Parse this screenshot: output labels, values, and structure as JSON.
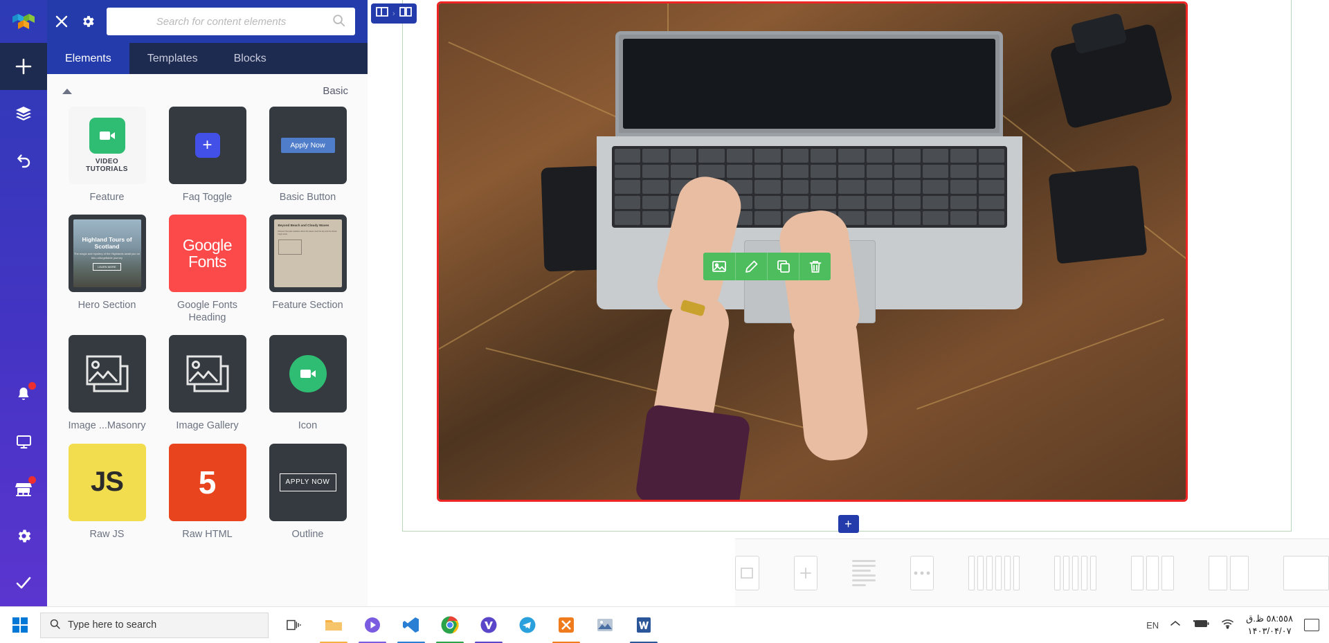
{
  "app": {
    "logo_icon": "colored-cubes-logo",
    "close_icon": "close-icon",
    "settings_icon": "gear-icon"
  },
  "rail": {
    "items": [
      {
        "icon": "plus-icon",
        "name": "add-element",
        "active": true,
        "badge": false
      },
      {
        "icon": "layers-icon",
        "name": "layers",
        "active": false,
        "badge": false
      },
      {
        "icon": "undo-icon",
        "name": "undo",
        "active": false,
        "badge": false
      },
      {
        "icon": "bell-icon",
        "name": "notifications",
        "active": false,
        "badge": true
      },
      {
        "icon": "monitor-icon",
        "name": "preview-desktop",
        "active": false,
        "badge": false
      },
      {
        "icon": "store-icon",
        "name": "marketplace",
        "active": false,
        "badge": true
      },
      {
        "icon": "gear-icon",
        "name": "settings",
        "active": false,
        "badge": false
      },
      {
        "icon": "check-icon",
        "name": "publish",
        "active": false,
        "badge": false
      }
    ]
  },
  "search": {
    "placeholder": "Search for content elements",
    "value": "",
    "icon": "search-icon"
  },
  "tabs": [
    {
      "label": "Elements",
      "active": true
    },
    {
      "label": "Templates",
      "active": false
    },
    {
      "label": "Blocks",
      "active": false
    }
  ],
  "group": {
    "title": "Basic",
    "collapse_icon": "caret-up-icon"
  },
  "elements": [
    {
      "label": "Feature",
      "thumb": "feature",
      "thumb_text_line1": "VIDEO",
      "thumb_text_line2": "TUTORIALS",
      "icon": "video-camera-icon"
    },
    {
      "label": "Faq Toggle",
      "thumb": "faq",
      "icon": "plus-icon"
    },
    {
      "label": "Basic Button",
      "thumb": "button",
      "button_label": "Apply Now"
    },
    {
      "label": "Hero Section",
      "thumb": "hero",
      "hero_title": "Highland Tours of Scotland",
      "hero_sub": "The magic and mystery of the Highlands await you on this unforgettable journey",
      "hero_button": "LEARN MORE"
    },
    {
      "label": "Google Fonts Heading",
      "thumb": "gfonts",
      "line1": "Google",
      "line2": "Fonts"
    },
    {
      "label": "Feature Section",
      "thumb": "featsec",
      "fs_title": "Beyond Beach and Cloudy Waves",
      "fs_body": "Discover the quiet coastline where the waves meet the sky and the stories begin anew."
    },
    {
      "label": "Image ...Masonry",
      "thumb": "dark",
      "icon": "images-stack-icon"
    },
    {
      "label": "Image Gallery",
      "thumb": "dark",
      "icon": "images-stack-icon"
    },
    {
      "label": "Icon",
      "thumb": "icon",
      "icon": "video-circle-icon"
    },
    {
      "label": "Raw JS",
      "thumb": "js",
      "text": "JS"
    },
    {
      "label": "Raw HTML",
      "thumb": "html5",
      "text": "5"
    },
    {
      "label": "Outline",
      "thumb": "outline",
      "button_label": "APPLY NOW"
    }
  ],
  "canvas": {
    "row_tools": {
      "layout_icon": "columns-layout-icon",
      "separator": "›",
      "split_icon": "split-columns-icon"
    },
    "image_toolbar": [
      {
        "icon": "image-icon",
        "name": "change-image"
      },
      {
        "icon": "pencil-icon",
        "name": "edit-image"
      },
      {
        "icon": "copy-icon",
        "name": "duplicate-image"
      },
      {
        "icon": "trash-icon",
        "name": "delete-image"
      }
    ],
    "add_block_icon": "plus-icon",
    "selection_color": "#ef2424",
    "toolbar_color": "#4dbd5e"
  },
  "bottom_strip": {
    "items": [
      {
        "name": "layout-single-box",
        "icon": "box-icon"
      },
      {
        "name": "layout-add",
        "icon": "plus-icon"
      },
      {
        "name": "layout-text",
        "icon": "text-lines-icon"
      },
      {
        "name": "layout-more",
        "icon": "dots-icon"
      },
      {
        "name": "layout-5-columns",
        "icon": "five-columns-icon"
      },
      {
        "name": "layout-4-columns",
        "icon": "four-columns-icon"
      },
      {
        "name": "layout-3-columns",
        "icon": "three-columns-icon"
      },
      {
        "name": "layout-2-columns",
        "icon": "two-columns-icon"
      },
      {
        "name": "layout-1-column",
        "icon": "one-column-icon"
      }
    ]
  },
  "taskbar": {
    "start_icon": "windows-logo",
    "search_placeholder": "Type here to search",
    "search_icon": "search-icon",
    "apps": [
      {
        "name": "task-view",
        "icon": "task-view-icon",
        "color": "#3a3a3a"
      },
      {
        "name": "file-explorer",
        "icon": "folder-icon",
        "color": "#f5b041"
      },
      {
        "name": "media-player",
        "icon": "media-player-icon",
        "color": "#7b5ce0"
      },
      {
        "name": "visual-studio-code",
        "icon": "vscode-icon",
        "color": "#2a7fd4"
      },
      {
        "name": "google-chrome",
        "icon": "chrome-icon",
        "color": "#2aa34a"
      },
      {
        "name": "vite-app",
        "icon": "v-icon",
        "color": "#5a46c8"
      },
      {
        "name": "telegram",
        "icon": "telegram-icon",
        "color": "#2aa0dc"
      },
      {
        "name": "xampp",
        "icon": "xampp-icon",
        "color": "#f07b1d"
      },
      {
        "name": "photos",
        "icon": "photos-icon",
        "color": "#4a6fa5"
      },
      {
        "name": "word",
        "icon": "word-icon",
        "color": "#2b579a"
      }
    ],
    "tray": {
      "language": "EN",
      "chevron_icon": "chevron-up-icon",
      "battery_icon": "battery-charging-icon",
      "network_icon": "wifi-icon",
      "time": "٥٨:٥٥٨ ظ.ق",
      "date": "۱۴۰۳/۰۴/۰۷",
      "action_center_icon": "notification-icon"
    }
  }
}
